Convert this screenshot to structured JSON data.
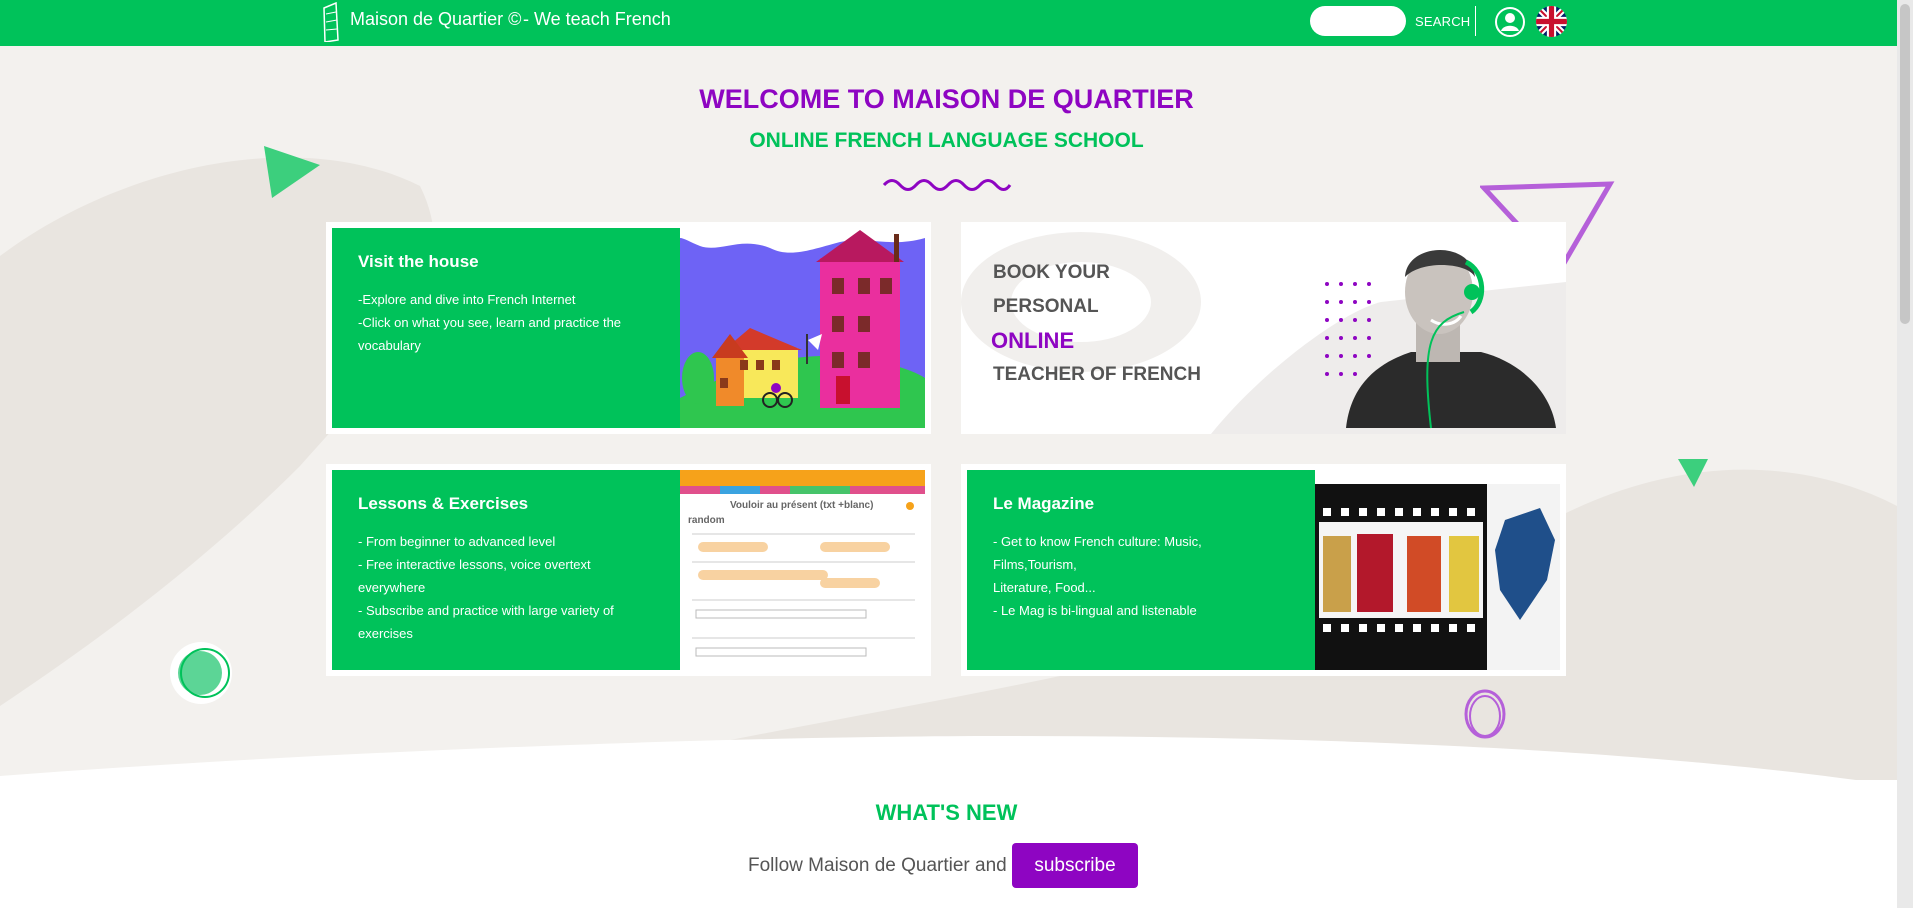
{
  "header": {
    "site_title": "Maison de Quartier ©",
    "tagline": "- We teach French",
    "search_placeholder": "",
    "search_label": "SEARCH",
    "brand_color": "#00c25a"
  },
  "hero": {
    "title": "WELCOME TO MAISON DE QUARTIER",
    "subtitle": "ONLINE FRENCH LANGUAGE SCHOOL",
    "accent_color": "#8e05c2"
  },
  "cards": {
    "visit": {
      "title": "Visit the house",
      "lines": [
        "-Explore and dive into French Internet",
        "-Click on what you see, learn and practice the",
        "vocabulary"
      ]
    },
    "teacher": {
      "line1": "BOOK YOUR",
      "line2": "PERSONAL",
      "line3": "ONLINE",
      "line4": "TEACHER OF FRENCH"
    },
    "lessons": {
      "title": "Lessons & Exercises",
      "lines": [
        "- From beginner to advanced level",
        "- Free interactive lessons, voice overtext",
        "everywhere",
        "- Subscribe and practice with large variety of",
        "exercises"
      ],
      "preview_title": "Vouloir au présent (txt +blanc)",
      "preview_sub": "random"
    },
    "magazine": {
      "title": "Le Magazine",
      "lines": [
        "- Get to know French culture: Music, Films,Tourism,",
        "Literature, Food...",
        "- Le Mag is bi-lingual and listenable"
      ]
    }
  },
  "whats_new": {
    "title": "WHAT'S NEW",
    "follow_text": "Follow Maison de Quartier and",
    "subscribe_label": "subscribe"
  }
}
